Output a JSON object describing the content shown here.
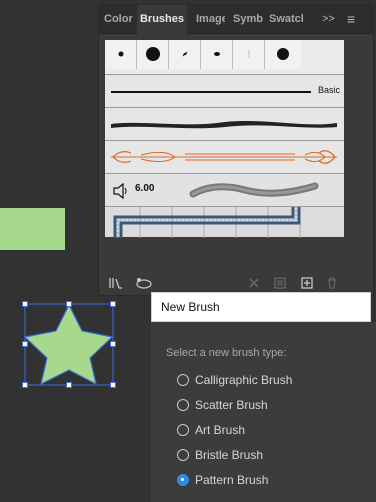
{
  "brushes_panel": {
    "tabs": [
      "Color",
      "Brushes",
      "Image",
      "Symb",
      "Swatcl"
    ],
    "active_tab": "Brushes",
    "overflow_label": ">>",
    "menu_label": "≡",
    "basic_label": "Basic",
    "art_brush_size": "6.00"
  },
  "tooltip": {
    "title": "New Brush"
  },
  "new_brush_dialog": {
    "prompt": "Select a new brush type:",
    "options": [
      {
        "label": "Calligraphic Brush",
        "selected": false
      },
      {
        "label": "Scatter Brush",
        "selected": false
      },
      {
        "label": "Art Brush",
        "selected": false
      },
      {
        "label": "Bristle Brush",
        "selected": false
      },
      {
        "label": "Pattern Brush",
        "selected": true
      }
    ]
  },
  "colors": {
    "shape_fill": "#a6d98c",
    "selection": "#3d6fe0",
    "accent_radio": "#2d8ceb",
    "art_stroke": "#d9682a"
  },
  "icons": [
    "library-icon",
    "brush-libraries-menu-icon",
    "remove-stroke-icon",
    "options-icon",
    "new-brush-icon",
    "delete-icon",
    "speaker-icon"
  ]
}
